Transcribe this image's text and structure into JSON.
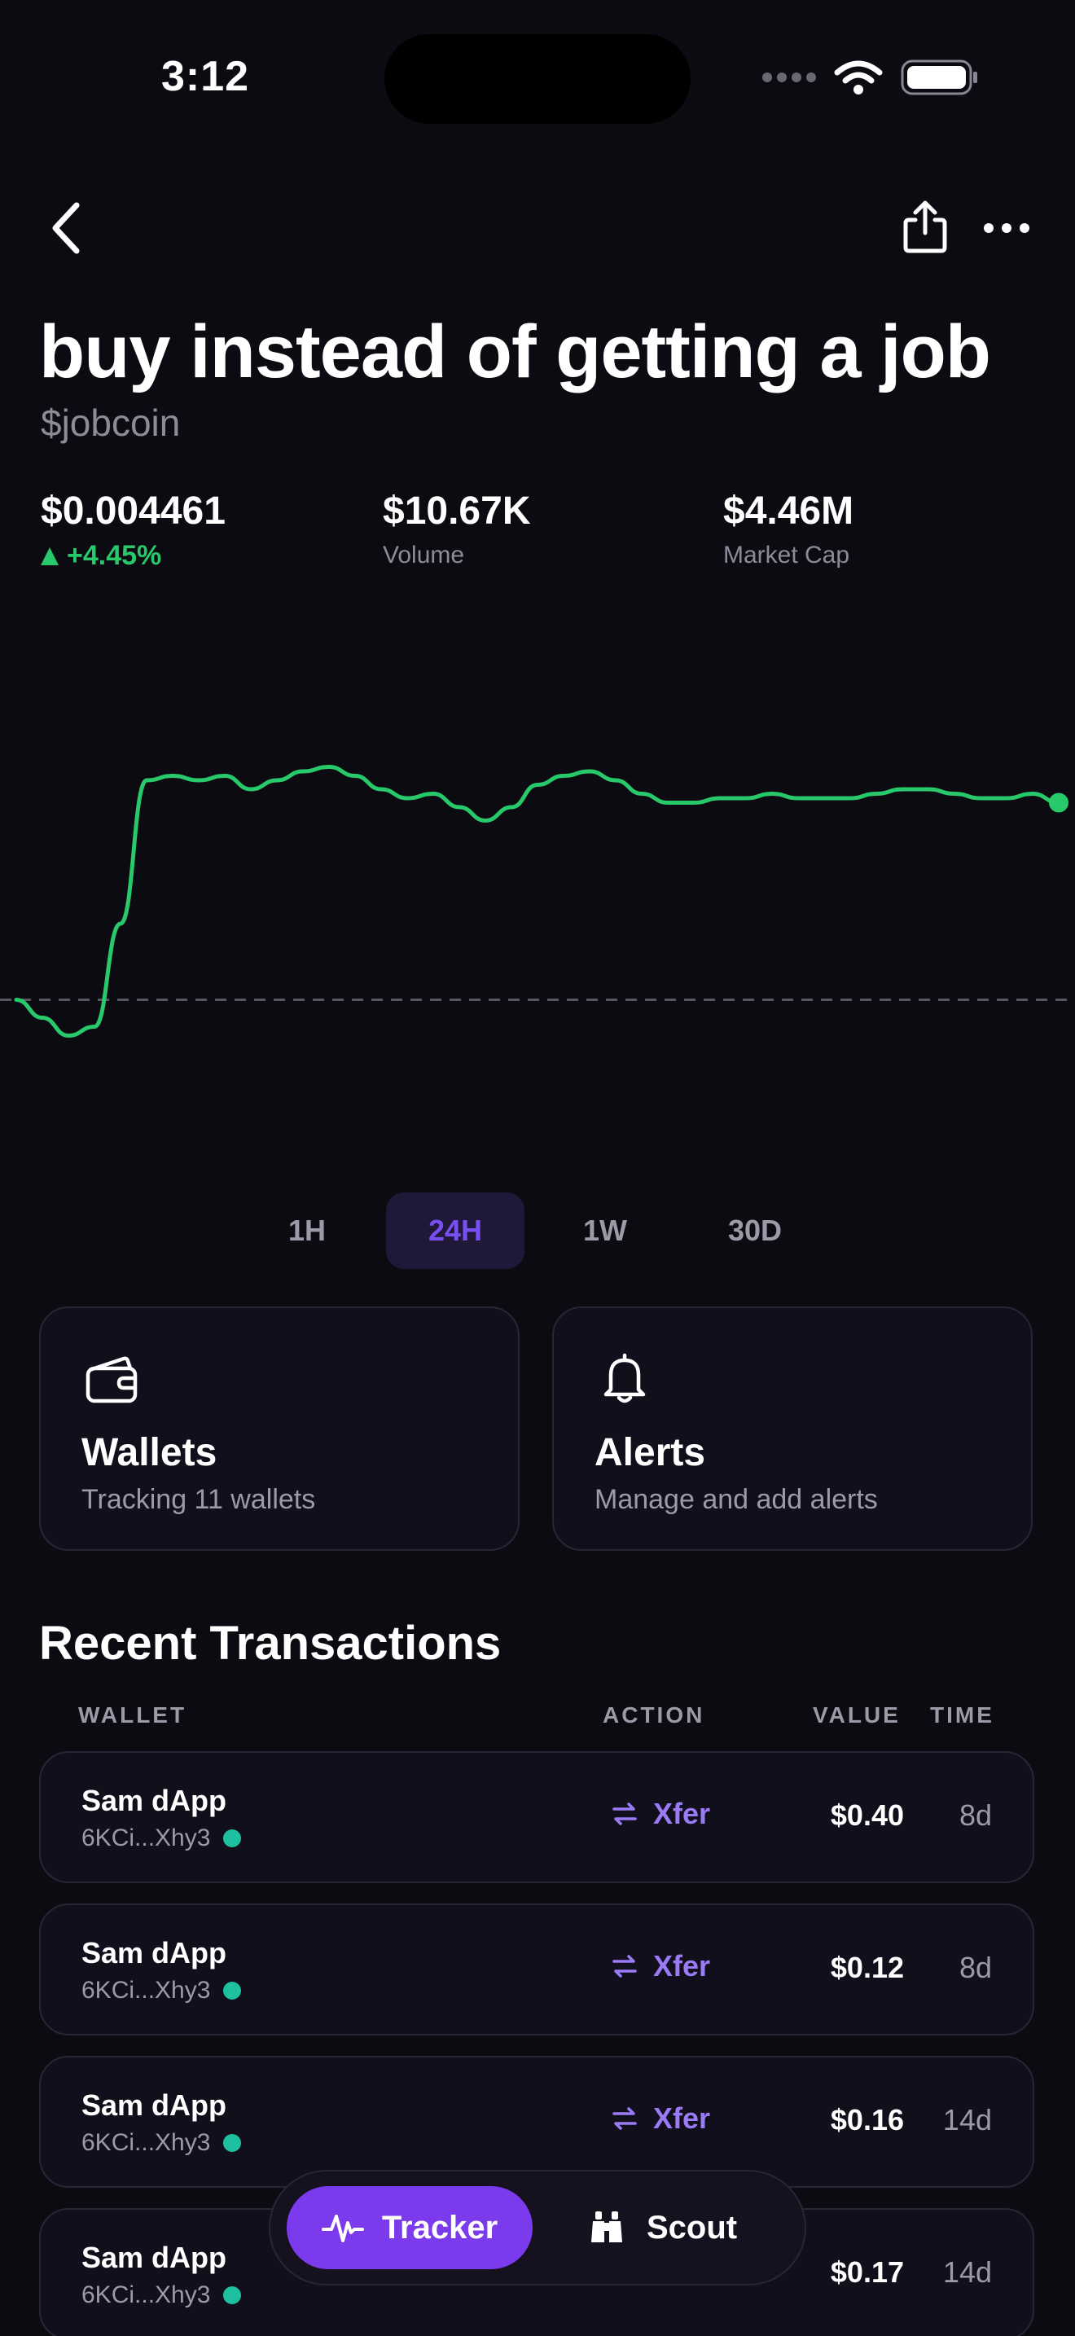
{
  "status_bar": {
    "time": "3:12"
  },
  "token": {
    "name": "buy instead of getting a job",
    "ticker": "$jobcoin"
  },
  "stats": {
    "price": "$0.004461",
    "change": "+4.45%",
    "volume_value": "$10.67K",
    "volume_label": "Volume",
    "market_cap_value": "$4.46M",
    "market_cap_label": "Market Cap"
  },
  "chart_data": {
    "type": "line",
    "title": "",
    "xlabel": "",
    "ylabel": "",
    "line_color": "#27c96a",
    "baseline_dashed": true,
    "ylim": [
      0,
      100
    ],
    "x": [
      0,
      1,
      2,
      3,
      4,
      5,
      6,
      7,
      8,
      9,
      10,
      11,
      12,
      13,
      14,
      15,
      16,
      17,
      18,
      19,
      20,
      21,
      22,
      23,
      24,
      25,
      26,
      27,
      28,
      29,
      30,
      31,
      32,
      33,
      34,
      35,
      36,
      37,
      38,
      39,
      40
    ],
    "values": [
      35,
      31,
      27,
      29,
      52,
      84,
      85,
      84,
      85,
      82,
      84,
      86,
      87,
      85,
      82,
      80,
      81,
      78,
      75,
      78,
      83,
      85,
      86,
      84,
      81,
      79,
      79,
      80,
      80,
      81,
      80,
      80,
      80,
      81,
      82,
      82,
      81,
      80,
      80,
      81,
      79
    ],
    "baseline": 35
  },
  "range_tabs": [
    "1H",
    "24H",
    "1W",
    "30D"
  ],
  "range_active_index": 1,
  "cards": {
    "wallets_title": "Wallets",
    "wallets_sub": "Tracking 11 wallets",
    "alerts_title": "Alerts",
    "alerts_sub": "Manage and add alerts"
  },
  "transactions": {
    "title": "Recent Transactions",
    "columns": [
      "WALLET",
      "ACTION",
      "VALUE",
      "TIME"
    ],
    "rows": [
      {
        "name": "Sam dApp",
        "addr": "6KCi...Xhy3",
        "action": "Xfer",
        "value": "$0.40",
        "time": "8d"
      },
      {
        "name": "Sam dApp",
        "addr": "6KCi...Xhy3",
        "action": "Xfer",
        "value": "$0.12",
        "time": "8d"
      },
      {
        "name": "Sam dApp",
        "addr": "6KCi...Xhy3",
        "action": "Xfer",
        "value": "$0.16",
        "time": "14d"
      },
      {
        "name": "Sam dApp",
        "addr": "6KCi...Xhy3",
        "action": "",
        "value": "$0.17",
        "time": "14d"
      }
    ]
  },
  "tabbar": {
    "tracker": "Tracker",
    "scout": "Scout"
  },
  "colors": {
    "accent": "#7c3aed",
    "positive": "#27c96a",
    "transfer": "#9b7af5",
    "background": "#0d0b12"
  }
}
